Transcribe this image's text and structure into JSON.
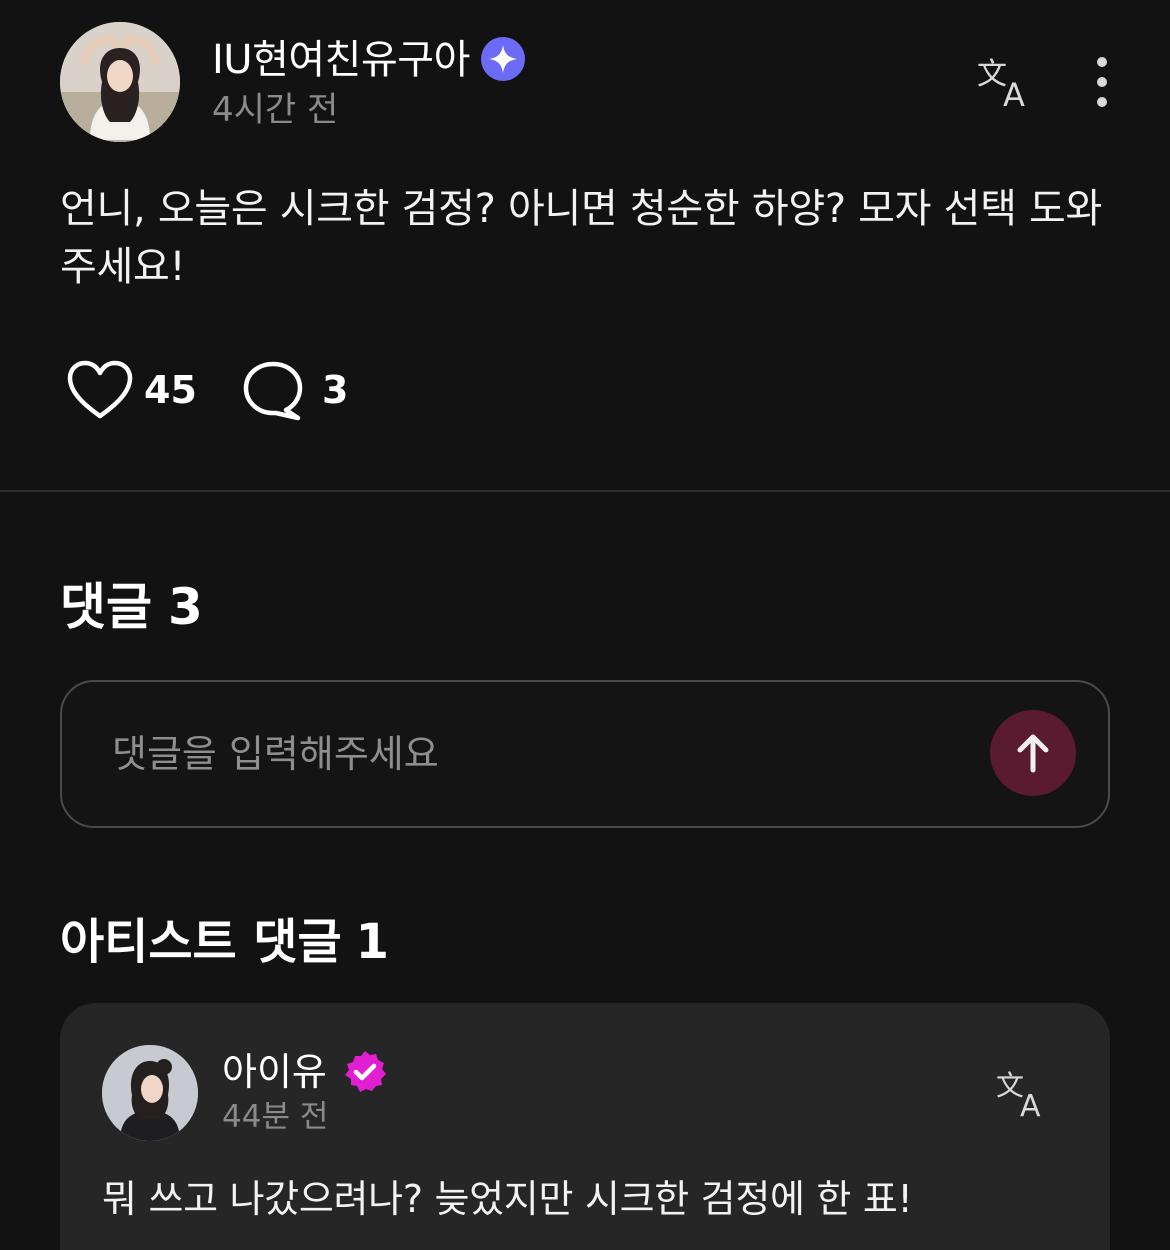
{
  "post": {
    "author": "IU현여친유구아",
    "time": "4시간 전",
    "body": "언니, 오늘은 시크한 검정? 아니면 청순한 하양? 모자 선택 도와주세요!",
    "likes": "45",
    "comments": "3"
  },
  "comments_section": {
    "title": "댓글",
    "count": "3",
    "input_placeholder": "댓글을 입력해주세요"
  },
  "artist_section": {
    "title": "아티스트 댓글",
    "count": "1",
    "comment": {
      "author": "아이유",
      "time": "44분 전",
      "text": "뭐 쓰고 나갔으려나? 늦었지만 시크한 검정에 한 표!"
    }
  },
  "icons": {
    "translate": "translate-icon",
    "more": "more-vertical-icon",
    "like": "heart-outline-icon",
    "comment": "comment-bubble-icon",
    "send": "arrow-up-icon",
    "fan_badge": "sparkle-badge-icon",
    "artist_badge": "verified-badge-icon"
  },
  "colors": {
    "background": "#121212",
    "card": "#262626",
    "fan_badge": "#6b6bf5",
    "artist_badge": "#e21fd0",
    "send_button": "#5a1a2f",
    "muted_text": "#8a8a8a"
  }
}
